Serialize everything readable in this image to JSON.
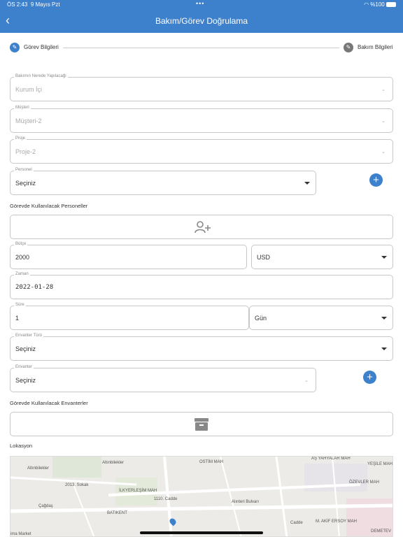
{
  "status_bar": {
    "time": "ÖS 2:43",
    "date": "9 Mayıs Pzt",
    "dots": "•••",
    "battery": "%100"
  },
  "header": {
    "title": "Bakım/Görev Doğrulama",
    "back_icon": "chevron-left-icon"
  },
  "colors": {
    "accent": "#3d80cc",
    "inactive_step": "#777777"
  },
  "stepper": {
    "step1": "Görev Bilgileri",
    "step2": "Bakım Bilgileri"
  },
  "form": {
    "location_type": {
      "label": "Bakımın Nerede Yapılacağı",
      "value": "Kurum İçi"
    },
    "customer": {
      "label": "Müşteri",
      "value": "Müşteri-2"
    },
    "project": {
      "label": "Proje",
      "value": "Proje-2"
    },
    "personnel": {
      "label": "Personel",
      "value": "Seçiniz"
    },
    "personnel_section": "Görevde Kullanılacak Personeller",
    "budget": {
      "label": "Bütçe",
      "value": "2000"
    },
    "currency": {
      "value": "USD"
    },
    "date": {
      "label": "Zaman",
      "value": "2022-01-28"
    },
    "duration": {
      "label": "Süre",
      "value": "1"
    },
    "duration_unit": {
      "value": "Gün"
    },
    "inventory_type": {
      "label": "Envanter Türü",
      "value": "Seçiniz"
    },
    "inventory": {
      "label": "Envanter",
      "value": "Seçiniz"
    },
    "inventory_section": "Görevde Kullanılacak Envanterler",
    "location_section": "Lokasyon"
  },
  "map": {
    "labels": [
      "Altınbilekler",
      "Altınbilekler",
      "OSTİM MAH",
      "AŞ YAHYALAR MAH",
      "YEŞİLE MAH",
      "Çağdaş",
      "İLKYERLEŞİM MAH",
      "2013. Sokak",
      "1110. Cadde",
      "Alınteri Bulvarı",
      "ÖZEVLER MAH",
      "BATIKENT",
      "M. AKİF ERSOY MAH",
      "DEMETEV",
      "Cadde",
      "ima Market"
    ]
  }
}
